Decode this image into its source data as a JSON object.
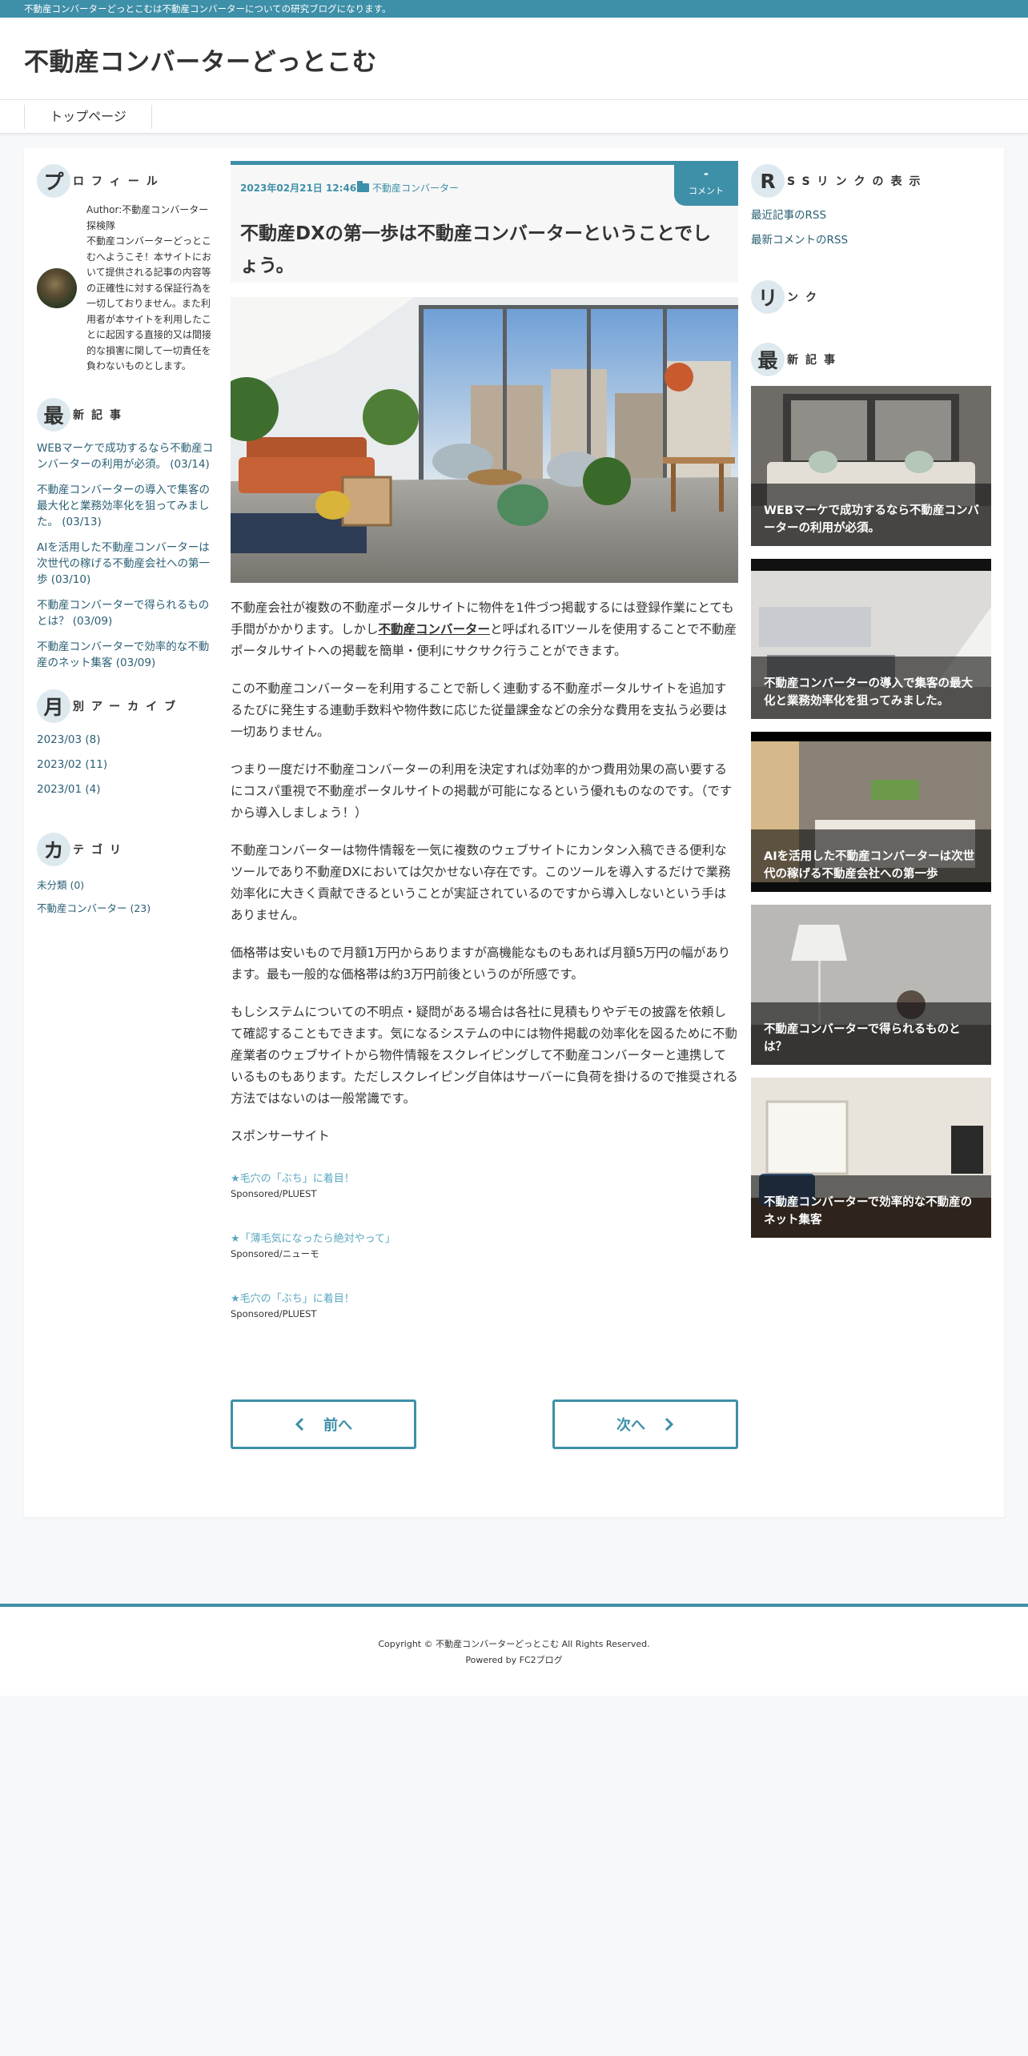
{
  "topbar": {
    "text": "不動産コンバーターどっとこむは不動産コンバーターについての研究ブログになります。"
  },
  "site": {
    "title": "不動産コンバーターどっとこむ"
  },
  "nav": {
    "items": [
      {
        "label": "トップページ"
      }
    ]
  },
  "left": {
    "profile": {
      "head_initial": "プ",
      "head_rest": "ロフィール",
      "text": "Author:不動産コンバーター探検隊\n不動産コンバーターどっとこむへようこそ！本サイトにおいて提供される記事の内容等の正確性に対する保証行為を一切しておりません。また利用者が本サイトを利用したことに起因する直接的又は間接的な損害に関して一切責任を負わないものとします。"
    },
    "recent": {
      "head_initial": "最",
      "head_rest": "新記事",
      "items": [
        "WEBマーケで成功するなら不動産コンバーターの利用が必須。 (03/14)",
        "不動産コンバーターの導入で集客の最大化と業務効率化を狙ってみました。 (03/13)",
        "AIを活用した不動産コンバーターは次世代の稼げる不動産会社への第一歩 (03/10)",
        "不動産コンバーターで得られるものとは？ (03/09)",
        "不動産コンバーターで効率的な不動産のネット集客 (03/09)"
      ]
    },
    "archive": {
      "head_initial": "月",
      "head_rest": "別アーカイブ",
      "items": [
        "2023/03 (8)",
        "2023/02 (11)",
        "2023/01 (4)"
      ]
    },
    "category": {
      "head_initial": "カ",
      "head_rest": "テゴリ",
      "items": [
        "未分類 (0)",
        "不動産コンバーター (23)"
      ]
    }
  },
  "article": {
    "date": "2023年02月21日 12:46",
    "category": "不動産コンバーター",
    "comment_count": "-",
    "comment_label": "コメント",
    "title": "不動産DXの第一歩は不動産コンバーターということでしょう。",
    "p1_a": "不動産会社が複数の不動産ポータルサイトに物件を1件づつ掲載するには登録作業にとても手間がかかります。しかし",
    "p1_kw": "不動産コンバーター",
    "p1_b": "と呼ばれるITツールを使用することで不動産ポータルサイトへの掲載を簡単・便利にサクサク行うことができます。",
    "p2": "この不動産コンバーターを利用することで新しく連動する不動産ポータルサイトを追加するたびに発生する連動手数料や物件数に応じた従量課金などの余分な費用を支払う必要は一切ありません。",
    "p3": "つまり一度だけ不動産コンバーターの利用を決定すれば効率的かつ費用効果の高い要するにコスパ重視で不動産ポータルサイトの掲載が可能になるという優れものなのです。（ですから導入しましょう！）",
    "p4": "不動産コンバーターは物件情報を一気に複数のウェブサイトにカンタン入稿できる便利なツールであり不動産DXにおいては欠かせない存在です。このツールを導入するだけで業務効率化に大きく貢献できるということが実証されているのですから導入しないという手はありません。",
    "p5": "価格帯は安いもので月額1万円からありますが高機能なものもあれば月額5万円の幅があります。最も一般的な価格帯は約3万円前後というのが所感です。",
    "p6": "もしシステムについての不明点・疑問がある場合は各社に見積もりやデモの披露を依頼して確認することもできます。気になるシステムの中には物件掲載の効率化を図るために不動産業者のウェブサイトから物件情報をスクレイピングして不動産コンバーターと連携しているものもあります。ただしスクレイピング自体はサーバーに負荷を掛けるので推奨される方法ではないのは一般常識です。",
    "sponsor_label": "スポンサーサイト",
    "ads": [
      {
        "title": "★毛穴の「ぶち」に着目！",
        "source": "Sponsored/PLUEST"
      },
      {
        "title": "★「薄毛気になったら絶対やって」",
        "source": "Sponsored/ニューモ"
      },
      {
        "title": "★毛穴の「ぶち」に着目！",
        "source": "Sponsored/PLUEST"
      }
    ]
  },
  "pager": {
    "prev": "前へ",
    "next": "次へ"
  },
  "right": {
    "rss": {
      "head_initial": "R",
      "head_rest": "SSリンクの表示",
      "links": [
        "最近記事のRSS",
        "最新コメントのRSS"
      ]
    },
    "links_widget": {
      "head_initial": "リ",
      "head_rest": "ンク"
    },
    "recent_cards": {
      "head_initial": "最",
      "head_rest": "新記事",
      "cards": [
        "WEBマーケで成功するなら不動産コンバーターの利用が必須。",
        "不動産コンバーターの導入で集客の最大化と業務効率化を狙ってみました。",
        "AIを活用した不動産コンバーターは次世代の稼げる不動産会社への第一歩",
        "不動産コンバーターで得られるものとは？",
        "不動産コンバーターで効率的な不動産のネット集客"
      ]
    }
  },
  "footer": {
    "copyright": "Copyright © 不動産コンバーターどっとこむ All Rights Reserved.",
    "powered": "Powered by FC2ブログ"
  },
  "colors": {
    "accent": "#3e8fa8",
    "link": "#2a5f74",
    "ad_link": "#5aa8c0"
  },
  "icons": [
    "folder-icon",
    "chevron-left-icon",
    "chevron-right-icon"
  ]
}
